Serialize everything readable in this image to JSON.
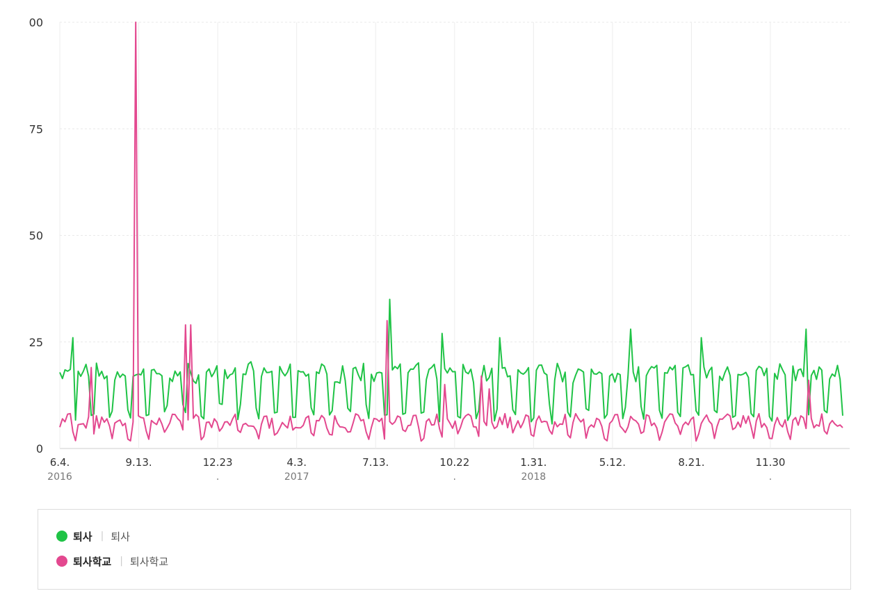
{
  "chart_data": {
    "type": "line",
    "y_ticks": [
      "00",
      "75",
      "50",
      "25",
      "0"
    ],
    "ylim": [
      0,
      100
    ],
    "x_ticks": [
      {
        "label": "6.4.",
        "sub": "2016"
      },
      {
        "label": "9.13.",
        "sub": ""
      },
      {
        "label": "12.23",
        "sub": "."
      },
      {
        "label": "4.3.",
        "sub": "2017"
      },
      {
        "label": "7.13.",
        "sub": ""
      },
      {
        "label": "10.22",
        "sub": "."
      },
      {
        "label": "1.31.",
        "sub": "2018"
      },
      {
        "label": "5.12.",
        "sub": ""
      },
      {
        "label": "8.21.",
        "sub": ""
      },
      {
        "label": "11.30",
        "sub": "."
      }
    ],
    "grid": true,
    "series": [
      {
        "name": "퇴사",
        "description": "퇴사",
        "color": "#1fc346",
        "baseline": 13,
        "weekly_amplitude": 6,
        "spikes": [
          [
            5,
            26
          ],
          [
            126,
            35
          ],
          [
            146,
            27
          ],
          [
            168,
            26
          ],
          [
            218,
            28
          ],
          [
            245,
            26
          ],
          [
            285,
            28
          ]
        ]
      },
      {
        "name": "퇴사학교",
        "description": "퇴사학교",
        "color": "#e3488f",
        "baseline": 5,
        "weekly_amplitude": 2,
        "spikes": [
          [
            12,
            19
          ],
          [
            29,
            100
          ],
          [
            48,
            29
          ],
          [
            50,
            29
          ],
          [
            125,
            30
          ],
          [
            147,
            15
          ],
          [
            161,
            17
          ],
          [
            164,
            14
          ],
          [
            286,
            16
          ]
        ]
      }
    ]
  },
  "legend": {
    "items": [
      {
        "name": "퇴사",
        "desc": "퇴사",
        "color": "#1fc346"
      },
      {
        "name": "퇴사학교",
        "desc": "퇴사학교",
        "color": "#e3488f"
      }
    ]
  }
}
